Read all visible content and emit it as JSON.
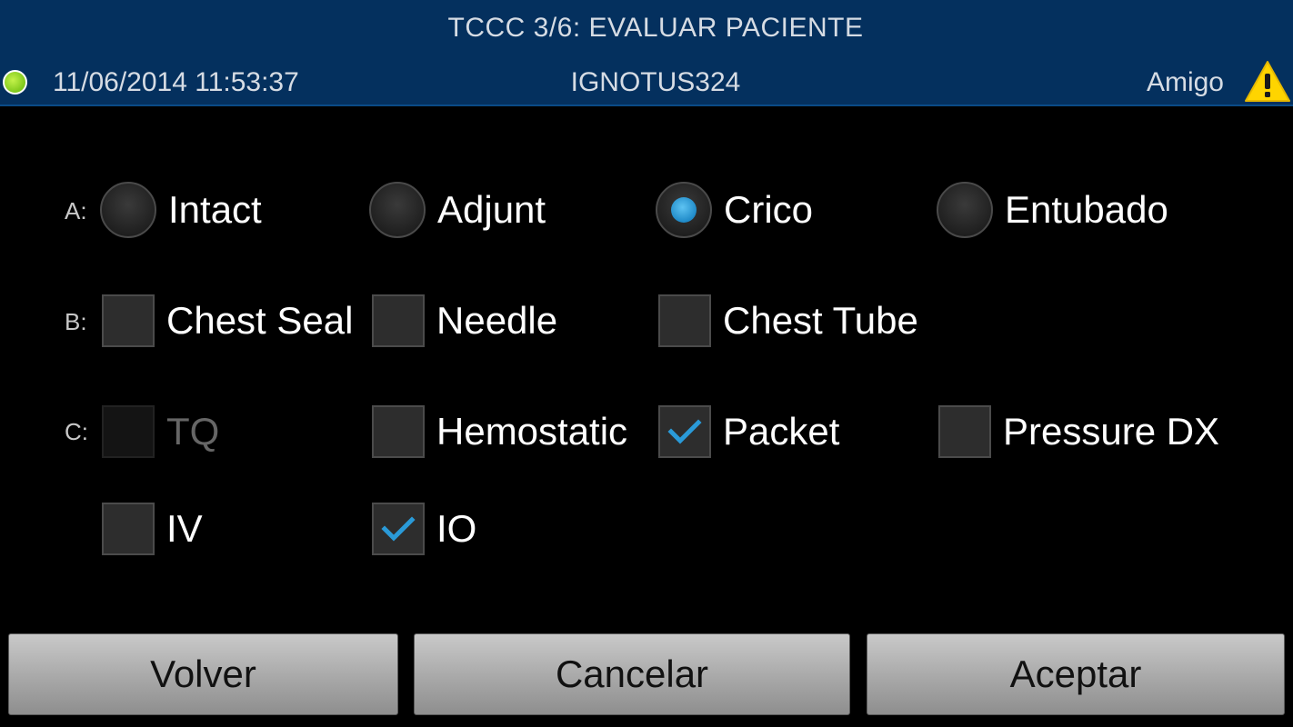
{
  "header": {
    "title": "TCCC 3/6: EVALUAR PACIENTE",
    "datetime": "11/06/2014 11:53:37",
    "user": "IGNOTUS324",
    "role": "Amigo",
    "status_color": "#7ec81b",
    "warning_icon": "warning-triangle-icon",
    "warning_color": "#ffd400"
  },
  "rows": {
    "a": {
      "label": "A:",
      "options": [
        {
          "label": "Intact",
          "type": "radio",
          "selected": false
        },
        {
          "label": "Adjunt",
          "type": "radio",
          "selected": false
        },
        {
          "label": "Crico",
          "type": "radio",
          "selected": true
        },
        {
          "label": "Entubado",
          "type": "radio",
          "selected": false
        }
      ]
    },
    "b": {
      "label": "B:",
      "options": [
        {
          "label": "Chest Seal",
          "type": "checkbox",
          "checked": false
        },
        {
          "label": "Needle",
          "type": "checkbox",
          "checked": false
        },
        {
          "label": "Chest Tube",
          "type": "checkbox",
          "checked": false
        }
      ]
    },
    "c": {
      "label": "C:",
      "options": [
        {
          "label": "TQ",
          "type": "checkbox",
          "checked": false,
          "disabled": true
        },
        {
          "label": "Hemostatic",
          "type": "checkbox",
          "checked": false
        },
        {
          "label": "Packet",
          "type": "checkbox",
          "checked": true
        },
        {
          "label": "Pressure DX",
          "type": "checkbox",
          "checked": false
        },
        {
          "label": "IV",
          "type": "checkbox",
          "checked": false
        },
        {
          "label": "IO",
          "type": "checkbox",
          "checked": true
        }
      ]
    }
  },
  "accent_color": "#2a9ad8",
  "buttons": {
    "back": "Volver",
    "cancel": "Cancelar",
    "accept": "Aceptar"
  }
}
